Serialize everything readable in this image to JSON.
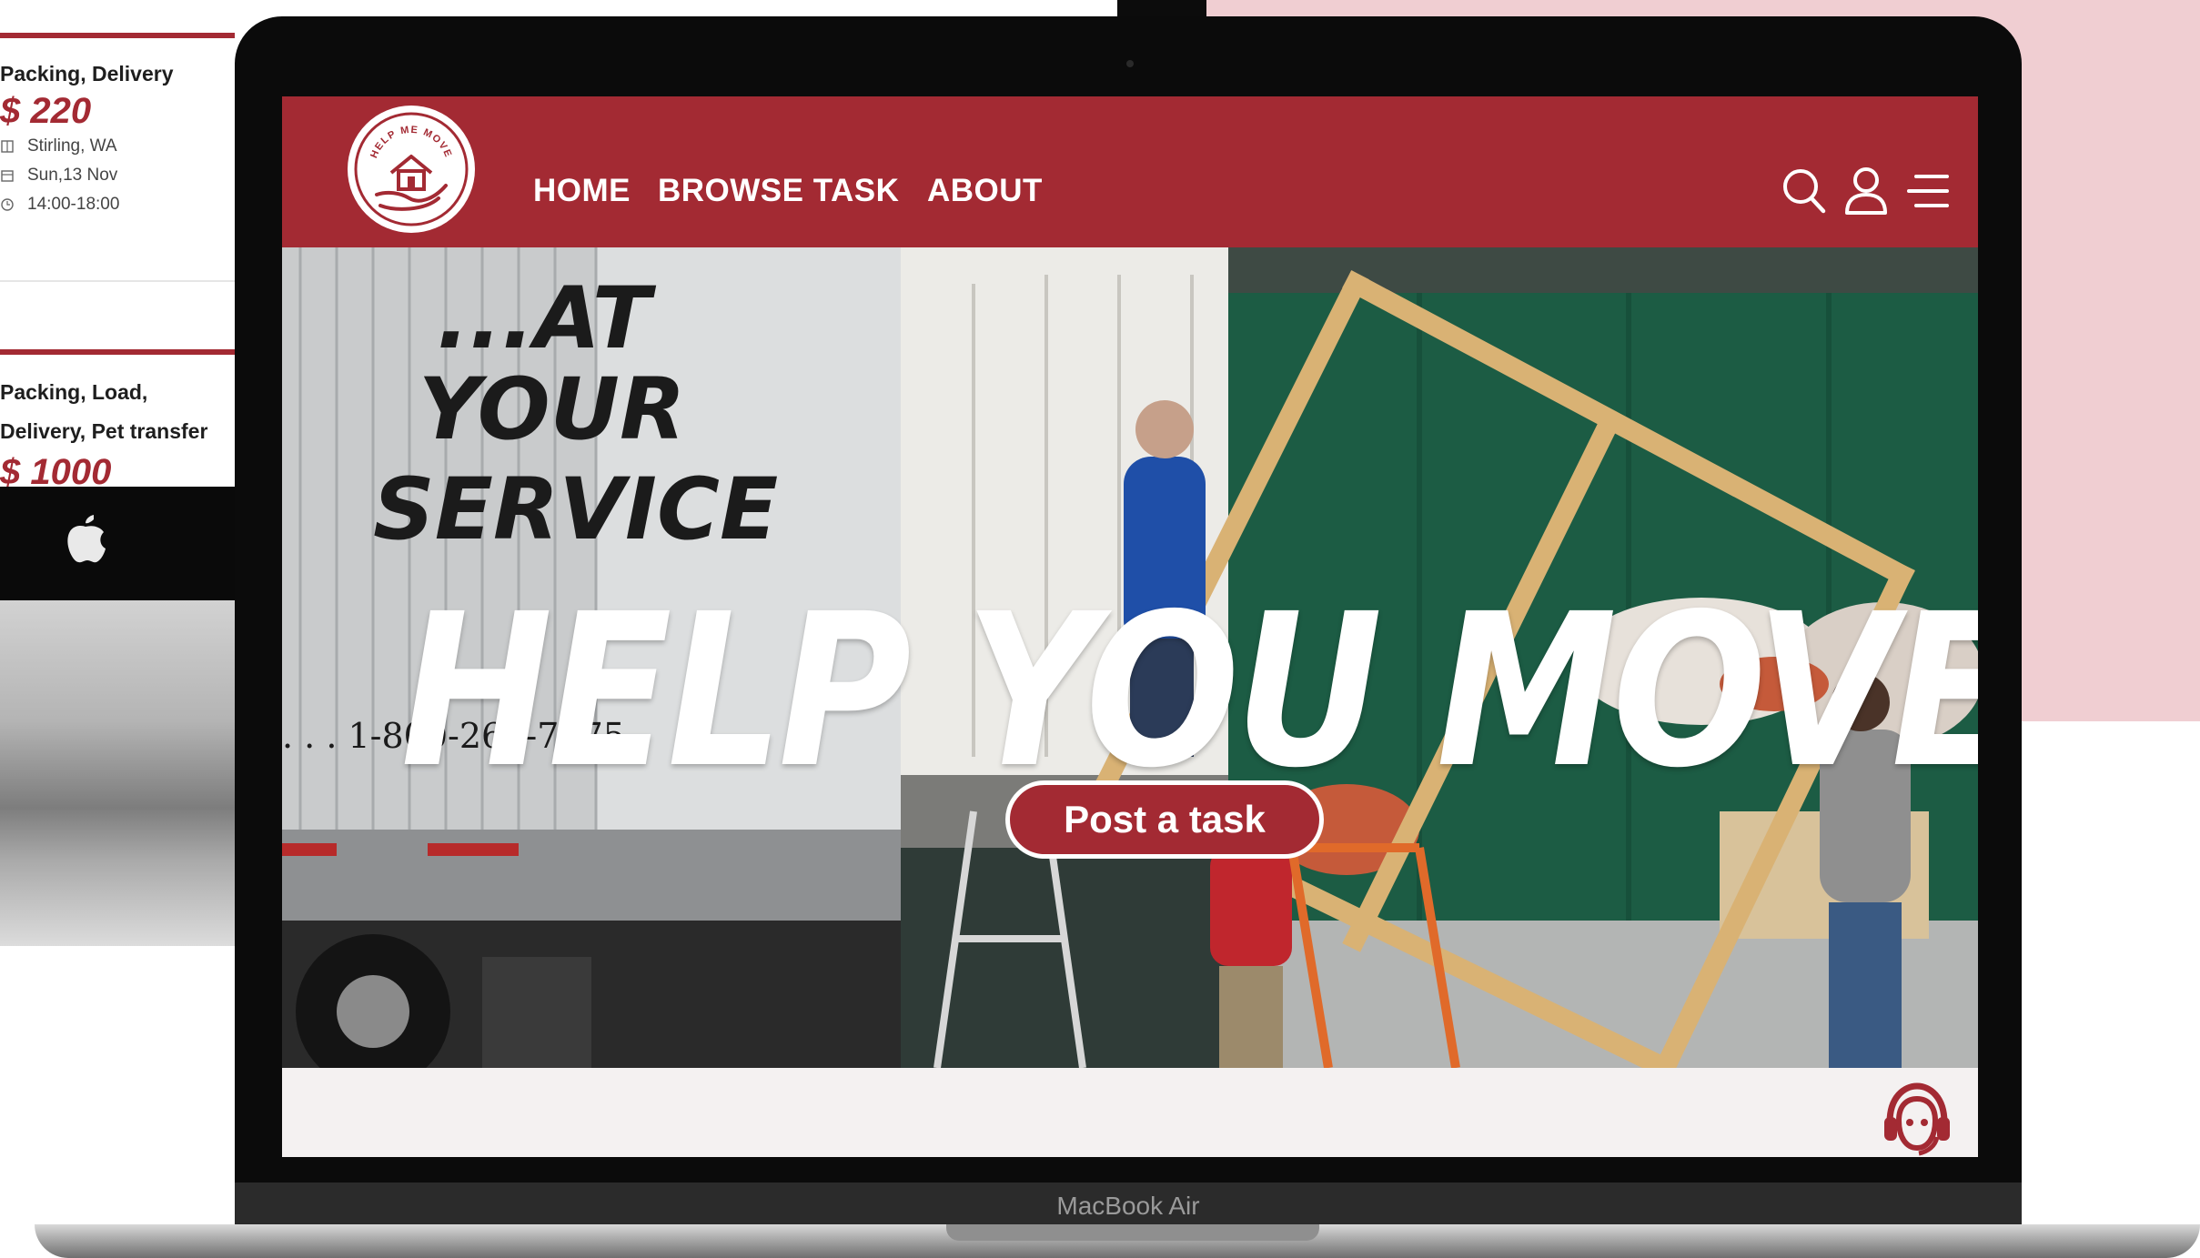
{
  "device": {
    "label": "MacBook Air"
  },
  "back_device": {
    "cards": [
      {
        "services": "Packing, Delivery",
        "price": "$ 220",
        "location": "Stirling, WA",
        "date": "Sun,13 Nov",
        "time": "14:00-18:00"
      },
      {
        "services_line1": "Packing, Load,",
        "services_line2": "Delivery, Pet transfer",
        "price": "$ 1000"
      }
    ]
  },
  "site": {
    "brand": {
      "logo_text": "HELP ME MOVE"
    },
    "nav": {
      "home": "HOME",
      "browse": "BROWSE TASK",
      "about": "ABOUT"
    },
    "icons": {
      "search": "search-icon",
      "user": "user-icon",
      "menu": "menu-icon",
      "support": "support-agent-icon"
    },
    "hero": {
      "title": "HELP YOU MOVE",
      "cta": "Post a task",
      "truck_text": {
        "line1": "...AT",
        "line2": "YOUR",
        "line3": "SERVICE",
        "phone": ". . . 1-800-265-7075"
      }
    }
  },
  "colors": {
    "brand": "#a32a33",
    "pink": "#f0ced2",
    "nav_text": "#ffffff"
  }
}
